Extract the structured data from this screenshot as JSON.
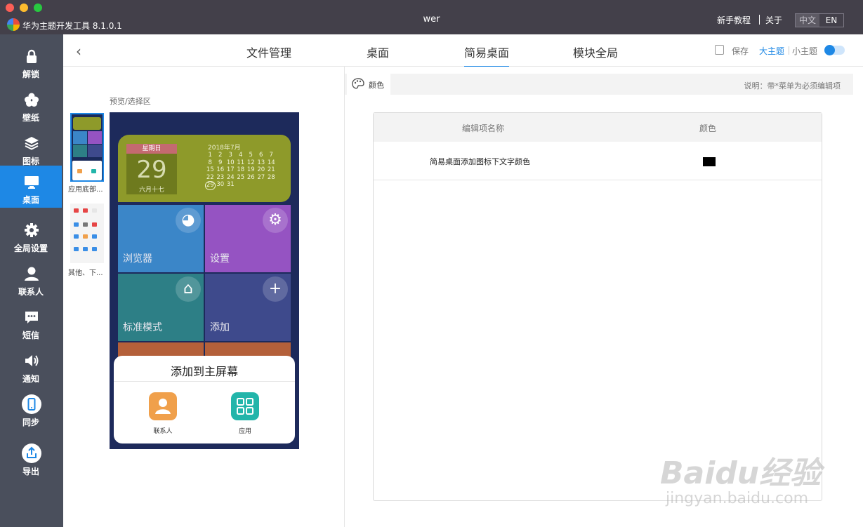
{
  "titlebar": {
    "app_name": "华为主题开发工具 8.1.0.1",
    "window_title": "wer",
    "tutorial": "新手教程",
    "about": "关于",
    "lang_zh": "中文",
    "lang_en": "EN"
  },
  "sidebar": {
    "items": [
      {
        "label": "解锁",
        "icon": "lock-icon"
      },
      {
        "label": "壁纸",
        "icon": "flower-icon"
      },
      {
        "label": "图标",
        "icon": "layers-icon"
      },
      {
        "label": "桌面",
        "icon": "monitor-icon",
        "active": true
      },
      {
        "label": "全局设置",
        "icon": "gear-icon"
      },
      {
        "label": "联系人",
        "icon": "person-icon"
      },
      {
        "label": "短信",
        "icon": "message-icon"
      },
      {
        "label": "通知",
        "icon": "speaker-icon"
      },
      {
        "label": "同步",
        "icon": "phone-sync-icon"
      },
      {
        "label": "导出",
        "icon": "export-icon"
      }
    ]
  },
  "nav": {
    "back_icon": "chevron-left-icon",
    "tabs": [
      "文件管理",
      "桌面",
      "简易桌面",
      "模块全局"
    ],
    "active_tab": "简易桌面",
    "save": "保存",
    "big_theme": "大主题",
    "small_theme": "小主题"
  },
  "preview": {
    "label": "预览/选择区",
    "thumbs": [
      "应用底部...",
      "其他、下..."
    ],
    "calendar": {
      "weekday": "星期日",
      "day": "29",
      "lunar": "六月十七",
      "month": "2018年7月",
      "dates": [
        "",
        "",
        "",
        "",
        "",
        "",
        "",
        "1",
        "2",
        "3",
        "4",
        "5",
        "6",
        "7",
        "8",
        "9",
        "10",
        "11",
        "12",
        "13",
        "14",
        "15",
        "16",
        "17",
        "18",
        "19",
        "20",
        "21",
        "22",
        "23",
        "24",
        "25",
        "26",
        "27",
        "28",
        "29",
        "30",
        "31"
      ]
    },
    "tiles": [
      {
        "name": "浏览器",
        "icon": "globe-icon"
      },
      {
        "name": "设置",
        "icon": "gear-icon"
      },
      {
        "name": "标准模式",
        "icon": "home-icon"
      },
      {
        "name": "添加",
        "icon": "plus-icon"
      }
    ],
    "sheet": {
      "title": "添加到主屏幕",
      "btn1": "联系人",
      "btn2": "应用"
    }
  },
  "editor": {
    "tab_label": "颜色",
    "note": "说明：带*菜单为必须编辑项",
    "columns": [
      "编辑项名称",
      "颜色"
    ],
    "rows": [
      {
        "name": "简易桌面添加图标下文字颜色",
        "color": "#000000"
      }
    ]
  },
  "watermark": {
    "main": "Baidu经验",
    "sub": "jingyan.baidu.com"
  },
  "colors": {
    "accent": "#1e88e5",
    "sidebar": "#4a4f5c",
    "titlebar": "#43404a"
  }
}
